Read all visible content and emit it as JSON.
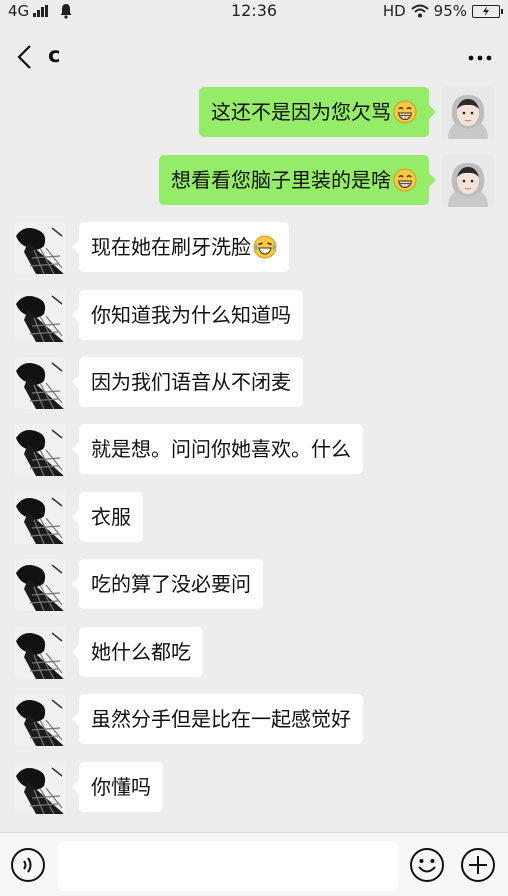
{
  "status_bar": {
    "network": "4G",
    "time": "12:36",
    "hd": "HD",
    "battery": "95%"
  },
  "nav": {
    "title": "c"
  },
  "messages": [
    {
      "side": "out",
      "text": "这还不是因为您欠骂",
      "emoji": "grin-icon"
    },
    {
      "side": "out",
      "text": "想看看您脑子里装的是啥",
      "emoji": "grin-icon"
    },
    {
      "side": "in",
      "text": "现在她在刷牙洗脸",
      "emoji": "crying-laughing-icon"
    },
    {
      "side": "in",
      "text": "你知道我为什么知道吗"
    },
    {
      "side": "in",
      "text": "因为我们语音从不闭麦"
    },
    {
      "side": "in",
      "text": "就是想。问问你她喜欢。什么"
    },
    {
      "side": "in",
      "text": "衣服"
    },
    {
      "side": "in",
      "text": "吃的算了没必要问"
    },
    {
      "side": "in",
      "text": "她什么都吃"
    },
    {
      "side": "in",
      "text": "虽然分手但是比在一起感觉好"
    },
    {
      "side": "in",
      "text": "你懂吗"
    }
  ],
  "input": {
    "value": ""
  },
  "colors": {
    "background": "#ededed",
    "outgoing_bubble": "#95ec69",
    "incoming_bubble": "#ffffff"
  }
}
